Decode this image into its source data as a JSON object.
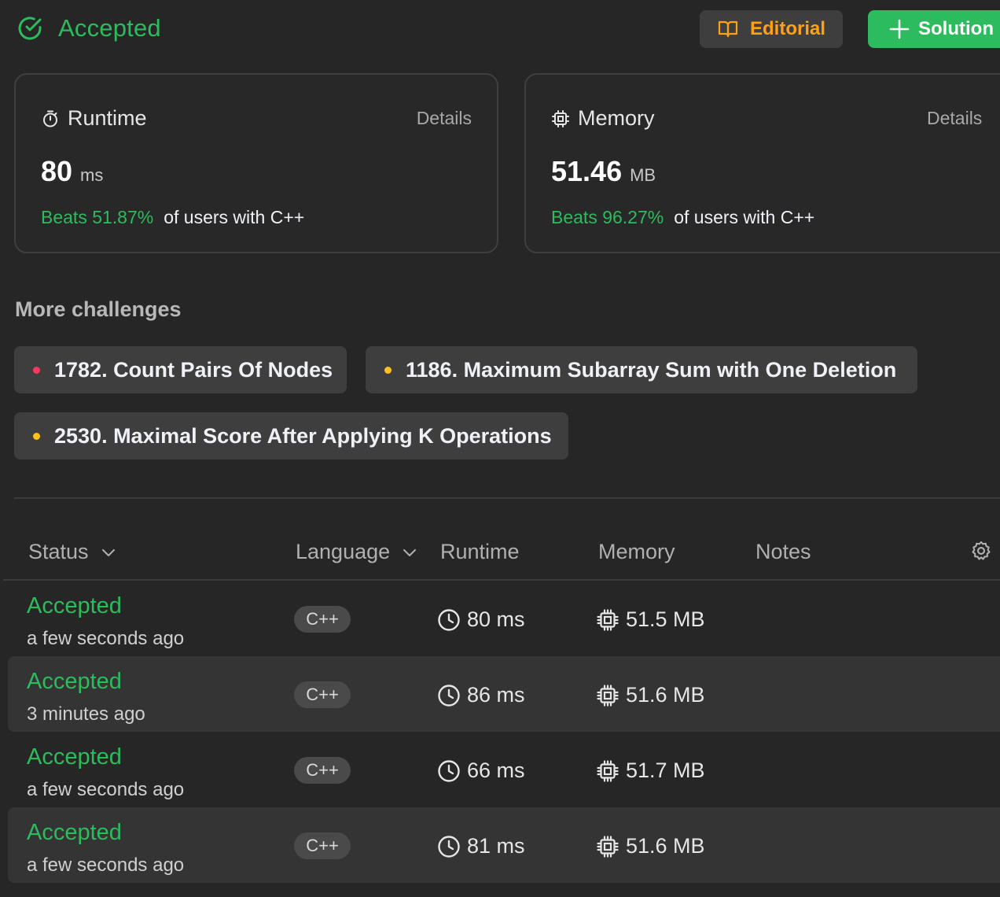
{
  "header": {
    "status": "Accepted",
    "editorial_label": "Editorial",
    "solution_label": "Solution"
  },
  "colors": {
    "accent_green": "#2cbb5d",
    "accent_orange": "#ffa116",
    "hard_red": "#ff375f",
    "medium_yellow": "#ffc01e"
  },
  "runtime_card": {
    "title": "Runtime",
    "details": "Details",
    "value": "80",
    "unit": "ms",
    "beats": "Beats 51.87%",
    "suffix": "of users with C++"
  },
  "memory_card": {
    "title": "Memory",
    "details": "Details",
    "value": "51.46",
    "unit": "MB",
    "beats": "Beats 96.27%",
    "suffix": "of users with C++"
  },
  "more": {
    "title": "More challenges",
    "challenges": [
      {
        "label": "1782. Count Pairs Of Nodes",
        "difficulty_color": "#ff375f"
      },
      {
        "label": "1186. Maximum Subarray Sum with One Deletion",
        "difficulty_color": "#ffc01e"
      },
      {
        "label": "2530. Maximal Score After Applying K Operations",
        "difficulty_color": "#ffc01e"
      }
    ]
  },
  "table": {
    "columns": {
      "status": "Status",
      "language": "Language",
      "runtime": "Runtime",
      "memory": "Memory",
      "notes": "Notes"
    },
    "rows": [
      {
        "status": "Accepted",
        "time": "a few seconds ago",
        "language": "C++",
        "runtime": "80 ms",
        "memory": "51.5 MB"
      },
      {
        "status": "Accepted",
        "time": "3 minutes ago",
        "language": "C++",
        "runtime": "86 ms",
        "memory": "51.6 MB"
      },
      {
        "status": "Accepted",
        "time": "a few seconds ago",
        "language": "C++",
        "runtime": "66 ms",
        "memory": "51.7 MB"
      },
      {
        "status": "Accepted",
        "time": "a few seconds ago",
        "language": "C++",
        "runtime": "81 ms",
        "memory": "51.6 MB"
      }
    ]
  }
}
